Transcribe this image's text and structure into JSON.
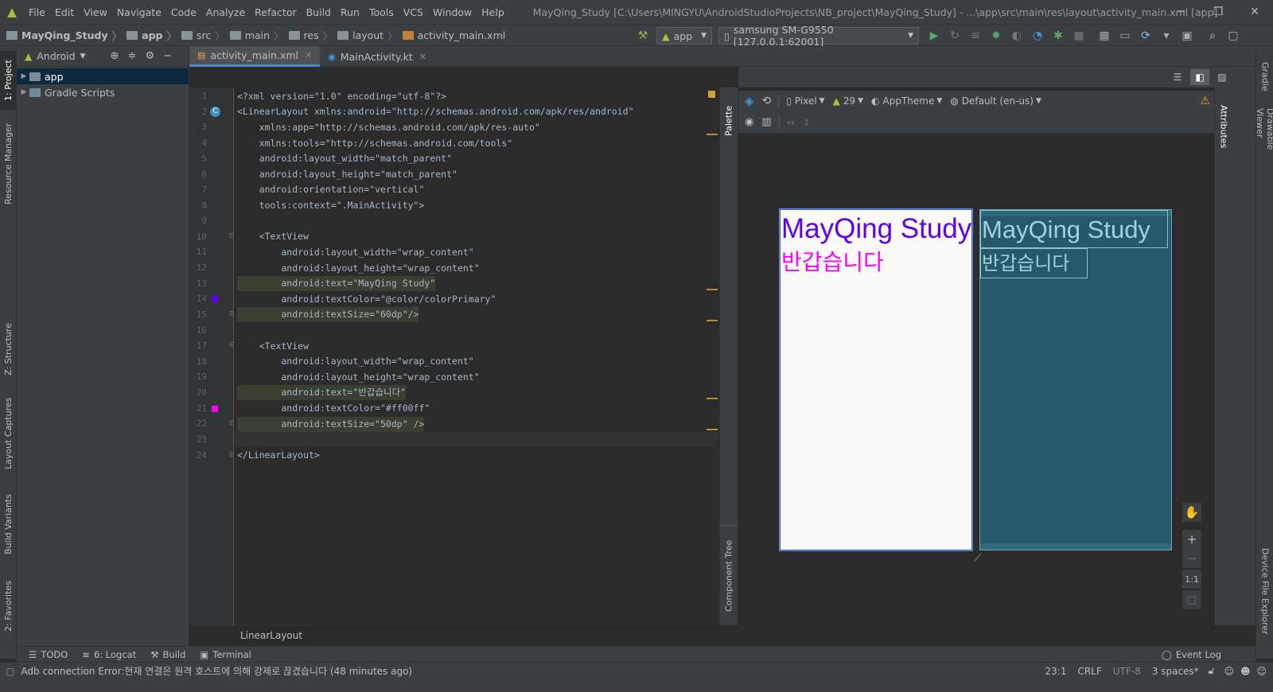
{
  "window": {
    "title": "MayQing_Study [C:\\Users\\MINGYU\\AndroidStudioProjects\\NB_project\\MayQing_Study] - ...\\app\\src\\main\\res\\layout\\activity_main.xml [app]",
    "menu": [
      "File",
      "Edit",
      "View",
      "Navigate",
      "Code",
      "Analyze",
      "Refactor",
      "Build",
      "Run",
      "Tools",
      "VCS",
      "Window",
      "Help"
    ]
  },
  "breadcrumbs": [
    "MayQing_Study",
    "app",
    "src",
    "main",
    "res",
    "layout",
    "activity_main.xml"
  ],
  "toolbar": {
    "run_config": "app",
    "device": "samsung SM-G9550 [127.0.0.1:62001]"
  },
  "project_panel": {
    "view_mode": "Android",
    "items": [
      {
        "label": "app",
        "selected": true
      },
      {
        "label": "Gradle Scripts",
        "selected": false
      }
    ]
  },
  "left_tool_tabs": [
    "1: Project",
    "Resource Manager",
    "Z: Structure",
    "Layout Captures",
    "Build Variants",
    "2: Favorites"
  ],
  "right_tool_tabs": [
    "Gradle",
    "Drawable Viewer",
    "Device File Explorer"
  ],
  "editor_tabs": [
    {
      "label": "activity_main.xml",
      "active": true
    },
    {
      "label": "MainActivity.kt",
      "active": false
    }
  ],
  "code": {
    "lines": [
      "<?xml version=\"1.0\" encoding=\"utf-8\"?>",
      "<LinearLayout xmlns:android=\"http://schemas.android.com/apk/res/android\"",
      "    xmlns:app=\"http://schemas.android.com/apk/res-auto\"",
      "    xmlns:tools=\"http://schemas.android.com/tools\"",
      "    android:layout_width=\"match_parent\"",
      "    android:layout_height=\"match_parent\"",
      "    android:orientation=\"vertical\"",
      "    tools:context=\".MainActivity\">",
      "",
      "    <TextView",
      "        android:layout_width=\"wrap_content\"",
      "        android:layout_height=\"wrap_content\"",
      "        android:text=\"MayQing Study\"",
      "        android:textColor=\"@color/colorPrimary\"",
      "        android:textSize=\"60dp\"/>",
      "",
      "    <TextView",
      "        android:layout_width=\"wrap_content\"",
      "        android:layout_height=\"wrap_content\"",
      "        android:text=\"반갑습니다\"",
      "        android:textColor=\"#ff00ff\"",
      "        android:textSize=\"50dp\" />",
      "",
      "</LinearLayout>"
    ],
    "footer_path": "LinearLayout"
  },
  "design": {
    "device": "Pixel",
    "api": "29",
    "theme": "AppTheme",
    "locale": "Default (en-us)",
    "palette_label": "Palette",
    "component_tree_label": "Component Tree",
    "attributes_label": "Attributes",
    "zoom_fit": "1:1",
    "preview": {
      "text1": "MayQing Study",
      "text1_color": "#6200ee",
      "text2": "반갑습니다",
      "text2_color": "#ff00ff"
    }
  },
  "bottom_tabs": [
    "TODO",
    "6: Logcat",
    "Build",
    "Terminal"
  ],
  "event_log": "Event Log",
  "status": {
    "message": "Adb connection Error:현재 연결은 원격 호스트에 의해 강제로 끊겼습니다 (48 minutes ago)",
    "position": "23:1",
    "line_sep": "CRLF",
    "encoding": "UTF-8",
    "indent": "3 spaces*"
  }
}
